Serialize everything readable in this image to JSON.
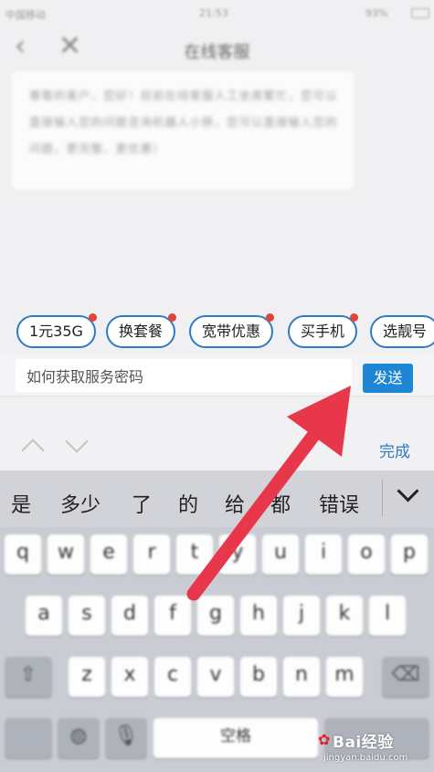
{
  "status_bar": {
    "carrier": "中国移动",
    "time": "21:53",
    "battery": "93%"
  },
  "nav": {
    "title": "在线客服",
    "back_icon": "back-chevron-icon",
    "close_icon": "close-icon"
  },
  "chat": {
    "bubble_text": "尊敬的客户，您好！目前在线客服人工坐席繁忙，您可以直接输入您的问题咨询机器人小移，您可以直接输入您的问题，更完整，更优惠）"
  },
  "quick_chips": [
    {
      "label": "1元35G"
    },
    {
      "label": "换套餐"
    },
    {
      "label": "宽带优惠"
    },
    {
      "label": "买手机"
    },
    {
      "label": "选靓号"
    }
  ],
  "composer": {
    "input_value": "如何获取服务密码",
    "send_label": "发送"
  },
  "accessory": {
    "done_label": "完成"
  },
  "keyboard": {
    "candidates": [
      "是",
      "多少",
      "了",
      "的",
      "给",
      "都",
      "错误"
    ],
    "row1": [
      "q",
      "w",
      "e",
      "r",
      "t",
      "y",
      "u",
      "i",
      "o",
      "p"
    ],
    "row2": [
      "a",
      "s",
      "d",
      "f",
      "g",
      "h",
      "j",
      "k",
      "l"
    ],
    "row3": [
      "z",
      "x",
      "c",
      "v",
      "b",
      "n",
      "m"
    ],
    "space_label": "空格"
  },
  "colors": {
    "accent": "#1f86d6",
    "chip_border": "#2e7bc4",
    "badge_red": "#e0443a",
    "arrow_red": "#e8374a"
  },
  "watermark": {
    "main": "Bai经验",
    "sub": "jingyan.baidu.com"
  }
}
